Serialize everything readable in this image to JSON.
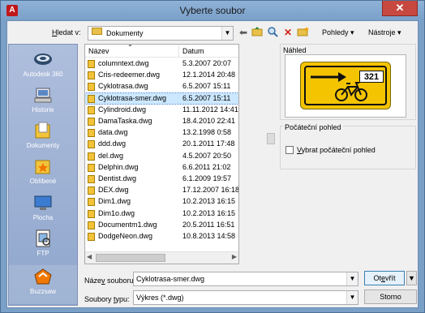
{
  "window": {
    "title": "Vyberte soubor",
    "close_glyph": "✕",
    "app_icon_letter": "A"
  },
  "lookin": {
    "label_mnemonic": "H",
    "label_rest": "ledat v:",
    "value": "Dokumenty"
  },
  "toolbar": {
    "views_label": "Pohledy",
    "tools_label": "Nástroje"
  },
  "places": [
    {
      "label": "Autodesk 360",
      "icon": "cloud-icon"
    },
    {
      "label": "Historie",
      "icon": "history-icon"
    },
    {
      "label": "Dokumenty",
      "icon": "documents-folder-icon"
    },
    {
      "label": "Oblíbené",
      "icon": "favorites-folder-icon"
    },
    {
      "label": "Plocha",
      "icon": "desktop-icon"
    },
    {
      "label": "FTP",
      "icon": "ftp-icon"
    },
    {
      "label": "Buzzsaw",
      "icon": "buzzsaw-icon"
    }
  ],
  "filelist": {
    "col_name": "Název",
    "col_date": "Datum",
    "rows": [
      {
        "name": "columntext.dwg",
        "date": "5.3.2007 20:07"
      },
      {
        "name": "Cris-redeemer.dwg",
        "date": "12.1.2014 20:48"
      },
      {
        "name": "Cyklotrasa.dwg",
        "date": "6.5.2007 15:11"
      },
      {
        "name": "Cyklotrasa-smer.dwg",
        "date": "6.5.2007 15:11"
      },
      {
        "name": "Cylindroid.dwg",
        "date": "11.11.2012 14:41"
      },
      {
        "name": "DamaTaska.dwg",
        "date": "18.4.2010 22:41"
      },
      {
        "name": "data.dwg",
        "date": "13.2.1998 0:58"
      },
      {
        "name": "ddd.dwg",
        "date": "20.1.2011 17:48"
      },
      {
        "name": "del.dwg",
        "date": "4.5.2007 20:50"
      },
      {
        "name": "Delphin.dwg",
        "date": "6.6.2011 21:02"
      },
      {
        "name": "Dentist.dwg",
        "date": "6.1.2009 19:57"
      },
      {
        "name": "DEX.dwg",
        "date": "17.12.2007 16:18"
      },
      {
        "name": "Dim1.dwg",
        "date": "10.2.2013 16:15"
      },
      {
        "name": "Dim1o.dwg",
        "date": "10.2.2013 16:15"
      },
      {
        "name": "Documentm1.dwg",
        "date": "20.5.2011 16:51"
      },
      {
        "name": "DodgeNeon.dwg",
        "date": "10.8.2013 14:58"
      }
    ]
  },
  "preview": {
    "label": "Náhled",
    "sign_number": "321"
  },
  "initial_view": {
    "label": "Počáteční pohled",
    "checkbox_mnemonic": "V",
    "checkbox_rest": "ybrat počáteční pohled"
  },
  "filename": {
    "label_pre": "Náze",
    "label_mnemonic": "v",
    "label_post": " souboru:",
    "value": "Cyklotrasa-smer.dwg"
  },
  "filetype": {
    "label_pre": "Soubory ",
    "label_mnemonic": "t",
    "label_post": "ypu:",
    "value": "Výkres (*.dwg)"
  },
  "buttons": {
    "open_pre": "Ot",
    "open_mnemonic": "e",
    "open_post": "vřít",
    "cancel": "Storno"
  }
}
